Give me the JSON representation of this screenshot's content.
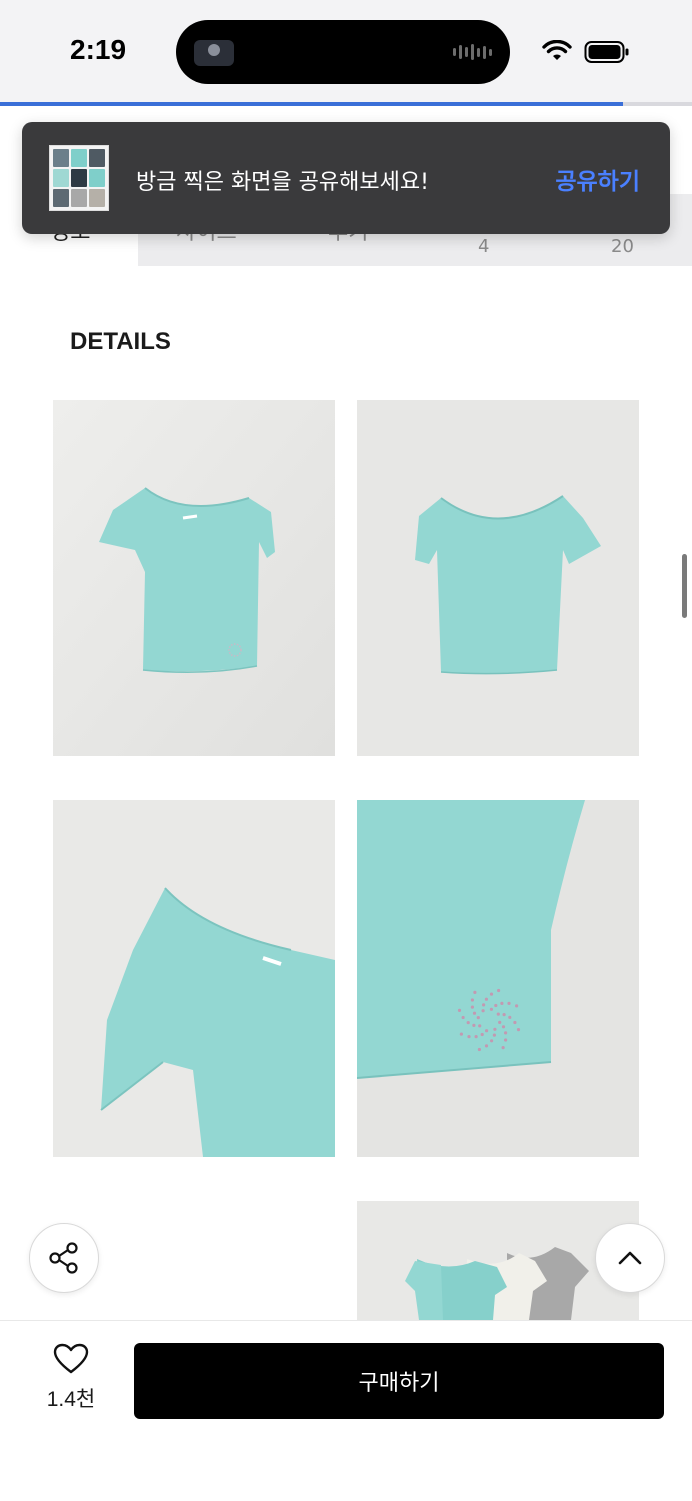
{
  "status_bar": {
    "time": "2:19",
    "icons": [
      "wifi-icon",
      "battery-icon"
    ]
  },
  "progress_fraction": 0.9,
  "tabs": {
    "first_label": "정보",
    "second_label": "사이즈",
    "third_label": "후기",
    "fourth_count": "4",
    "fifth_count": "20"
  },
  "toast": {
    "message": "방금 찍은 화면을 공유해보세요!",
    "action": "공유하기"
  },
  "details": {
    "title": "DETAILS"
  },
  "product_images": [
    {
      "name": "product-photo-front",
      "alt": "front view"
    },
    {
      "name": "product-photo-back",
      "alt": "back view"
    },
    {
      "name": "product-photo-shoulder-detail",
      "alt": "shoulder detail"
    },
    {
      "name": "product-photo-hem-detail",
      "alt": "hem detail"
    },
    {
      "name": "product-photo-colors",
      "alt": "color options"
    }
  ],
  "floating_buttons": {
    "share_icon": "share-icon",
    "top_icon": "chevron-up-icon"
  },
  "bottom_bar": {
    "like_count": "1.4천",
    "buy_label": "구매하기"
  },
  "colors": {
    "accent": "#4a80ff",
    "progress": "#3a6fd8",
    "product_mint": "#93d7d2",
    "buy_button": "#000000"
  }
}
